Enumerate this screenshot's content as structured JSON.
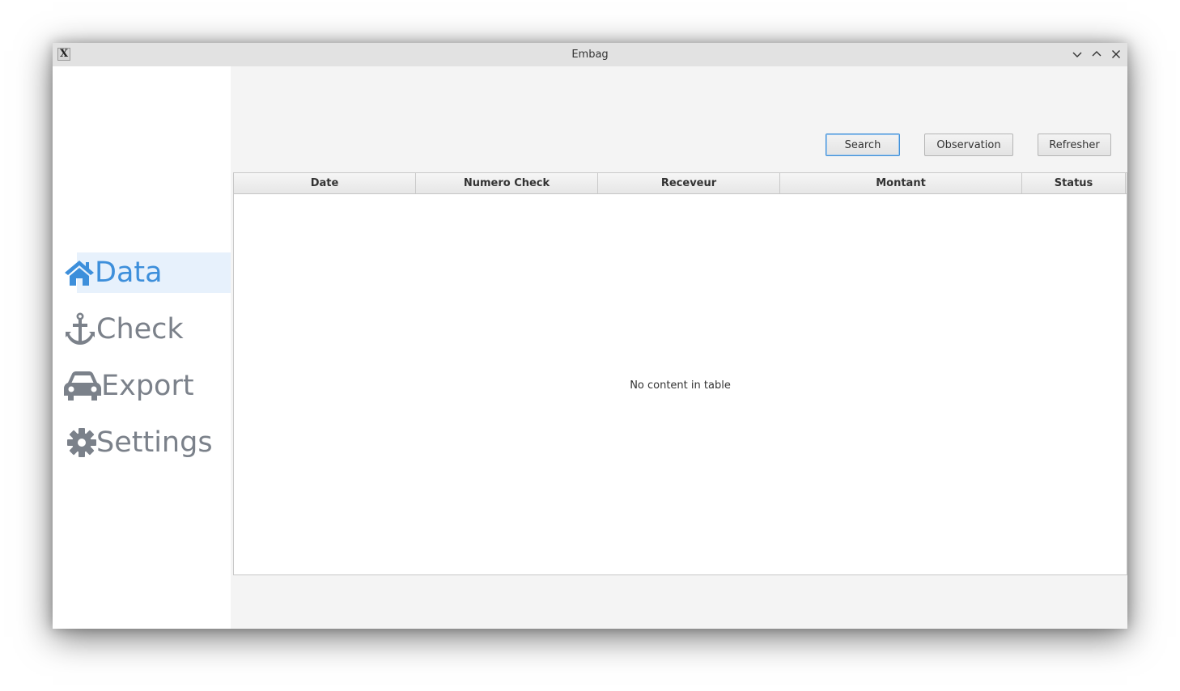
{
  "window": {
    "title": "Embag",
    "app_icon_glyph": "X"
  },
  "sidebar": {
    "items": [
      {
        "label": "Data",
        "icon": "home-icon",
        "active": true
      },
      {
        "label": "Check",
        "icon": "anchor-icon",
        "active": false
      },
      {
        "label": "Export",
        "icon": "car-icon",
        "active": false
      },
      {
        "label": "Settings",
        "icon": "gear-icon",
        "active": false
      }
    ]
  },
  "toolbar": {
    "search_label": "Search",
    "observation_label": "Observation",
    "refresher_label": "Refresher"
  },
  "table": {
    "columns": [
      "Date",
      "Numero Check",
      "Receveur",
      "Montant",
      "Status"
    ],
    "rows": [],
    "empty_text": "No content in table"
  },
  "colors": {
    "accent": "#3d8fdb",
    "nav_inactive": "#7b818a",
    "active_bg": "#e7f1fc",
    "content_bg": "#f4f4f4"
  }
}
